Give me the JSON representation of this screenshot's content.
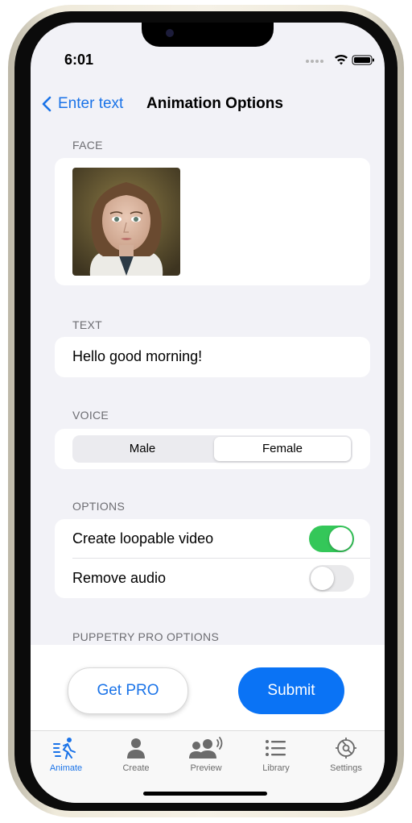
{
  "status": {
    "time": "6:01"
  },
  "nav": {
    "back_label": "Enter text",
    "title": "Animation Options"
  },
  "face": {
    "section_label": "FACE"
  },
  "text": {
    "section_label": "TEXT",
    "value": "Hello good morning!"
  },
  "voice": {
    "section_label": "VOICE",
    "options": [
      "Male",
      "Female"
    ],
    "selected": "Female"
  },
  "options": {
    "section_label": "OPTIONS",
    "items": [
      {
        "label": "Create loopable video",
        "enabled": true
      },
      {
        "label": "Remove audio",
        "enabled": false
      }
    ]
  },
  "pro_options": {
    "section_label": "PUPPETRY PRO OPTIONS"
  },
  "actions": {
    "get_pro_label": "Get PRO",
    "submit_label": "Submit"
  },
  "tabs": [
    {
      "label": "Animate",
      "icon": "animate-runner-icon",
      "active": true
    },
    {
      "label": "Create",
      "icon": "person-icon",
      "active": false
    },
    {
      "label": "Preview",
      "icon": "people-speaking-icon",
      "active": false
    },
    {
      "label": "Library",
      "icon": "list-icon",
      "active": false
    },
    {
      "label": "Settings",
      "icon": "gear-icon",
      "active": false
    }
  ],
  "colors": {
    "accent": "#1a73e8",
    "submit": "#0a73f5",
    "toggle_on": "#34c759",
    "toggle_off": "#e9e9eb",
    "background": "#f2f2f7"
  }
}
